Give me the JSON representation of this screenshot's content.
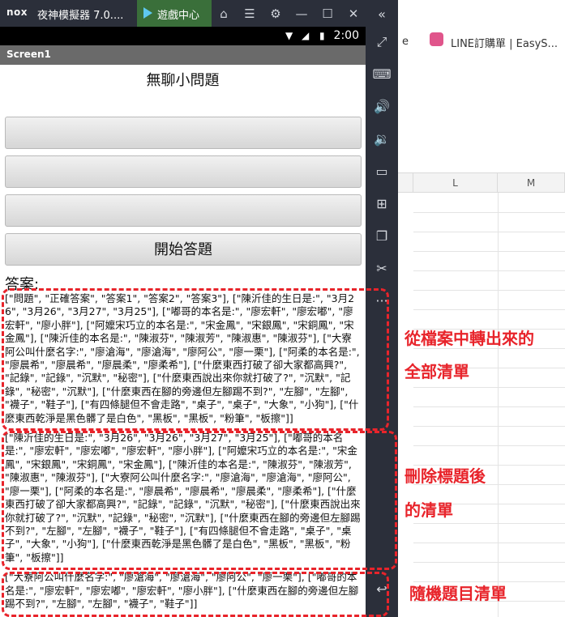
{
  "titlebar": {
    "logo": "nox",
    "app_title": "夜神模擬器 7.0....",
    "game_center_tab": "遊戲中心",
    "icons": [
      "home-icon",
      "menu-icon",
      "gear-icon",
      "minimize-icon",
      "maximize-icon",
      "close-icon",
      "collapse-chevron-icon"
    ]
  },
  "browser_bg": {
    "bookmark1": "e",
    "bookmark2": "LINE訂購單 | EasyS..."
  },
  "sheet": {
    "columns": [
      "L",
      "M"
    ]
  },
  "status_bar": {
    "time": "2:00"
  },
  "app": {
    "screen_title": "Screen1",
    "heading": "無聊小問題",
    "buttons": [
      "",
      "",
      "",
      "開始答題"
    ],
    "answer_label": "答案:",
    "full_list": "[\"問題\", \"正確答案\", \"答案1\", \"答案2\", \"答案3\"], [\"陳沂佳的生日是:\", \"3月26\", \"3月26\", \"3月27\", \"3月25\"], [\"嘟哥的本名是:\", \"廖宏軒\", \"廖宏嘟\", \"廖宏軒\", \"廖小胖\"], [\"阿嬤宋巧立的本名是:\", \"宋金鳳\", \"宋銀鳳\", \"宋銅鳳\", \"宋金鳳\"], [\"陳沂佳的本名是:\", \"陳淑芬\", \"陳淑芳\", \"陳淑惠\", \"陳淑芬\"], [\"大寮阿公叫什麼名字:\", \"廖滄海\", \"廖滄海\", \"廖阿公\", \"廖一栗\"], [\"阿柔的本名是:\", \"廖晨希\", \"廖晨希\", \"廖晨柔\", \"廖柔希\"], [\"什麼東西打破了卻大家都高興?\", \"記錄\", \"記錄\", \"沉默\", \"秘密\"], [\"什麼東西說出來你就打破了?\", \"沉默\", \"記錄\", \"秘密\", \"沉默\"], [\"什麼東西在腳的旁邊但左腳踢不到?\", \"左腳\", \"左腳\", \"襪子\", \"鞋子\"], [\"有四條腿但不會走路\", \"桌子\", \"桌子\", \"大象\", \"小狗\"], [\"什麼東西乾淨是黑色髒了是白色\", \"黑板\", \"黑板\", \"粉筆\", \"板擦\"]]",
    "no_header_list": "[\"陳沂佳的生日是:\", \"3月26\", \"3月26\", \"3月27\", \"3月25\"], [\"嘟哥的本名是:\", \"廖宏軒\", \"廖宏嘟\", \"廖宏軒\", \"廖小胖\"], [\"阿嬤宋巧立的本名是:\", \"宋金鳳\", \"宋銀鳳\", \"宋銅鳳\", \"宋金鳳\"], [\"陳沂佳的本名是:\", \"陳淑芬\", \"陳淑芳\", \"陳淑惠\", \"陳淑芬\"], [\"大寮阿公叫什麼名字:\", \"廖滄海\", \"廖滄海\", \"廖阿公\", \"廖一栗\"], [\"阿柔的本名是:\", \"廖晨希\", \"廖晨希\", \"廖晨柔\", \"廖柔希\"], [\"什麼東西打破了卻大家都高興?\", \"記錄\", \"記錄\", \"沉默\", \"秘密\"], [\"什麼東西說出來你就打破了?\", \"沉默\", \"記錄\", \"秘密\", \"沉默\"], [\"什麼東西在腳的旁邊但左腳踢不到?\", \"左腳\", \"左腳\", \"襪子\", \"鞋子\"], [\"有四條腿但不會走路\", \"桌子\", \"桌子\", \"大象\", \"小狗\"], [\"什麼東西乾淨是黑色髒了是白色\", \"黑板\", \"黑板\", \"粉筆\", \"板擦\"]]",
    "random_list": "[\"大寮阿公叫什麼名字:\", \"廖滄海\", \"廖滄海\", \"廖阿公\", \"廖一栗\"], [\"嘟哥的本名是:\", \"廖宏軒\", \"廖宏嘟\", \"廖宏軒\", \"廖小胖\"], [\"什麼東西在腳的旁邊但左腳踢不到?\", \"左腳\", \"左腳\", \"襪子\", \"鞋子\"]]"
  },
  "annotations": {
    "full_list_line1": "從檔案中轉出來的",
    "full_list_line2": "全部清單",
    "removed_header_line1": "刪除標題後",
    "removed_header_line2": "的清單",
    "random_list": "隨機題目清單",
    "color": "#e8242b"
  },
  "sidebar_icons": [
    "fullscreen-icon",
    "keyboard-icon",
    "volume-up-icon",
    "volume-down-icon",
    "screen-icon",
    "apk-install-icon",
    "multi-instance-icon",
    "scissors-icon",
    "more-icon",
    "back-icon"
  ]
}
